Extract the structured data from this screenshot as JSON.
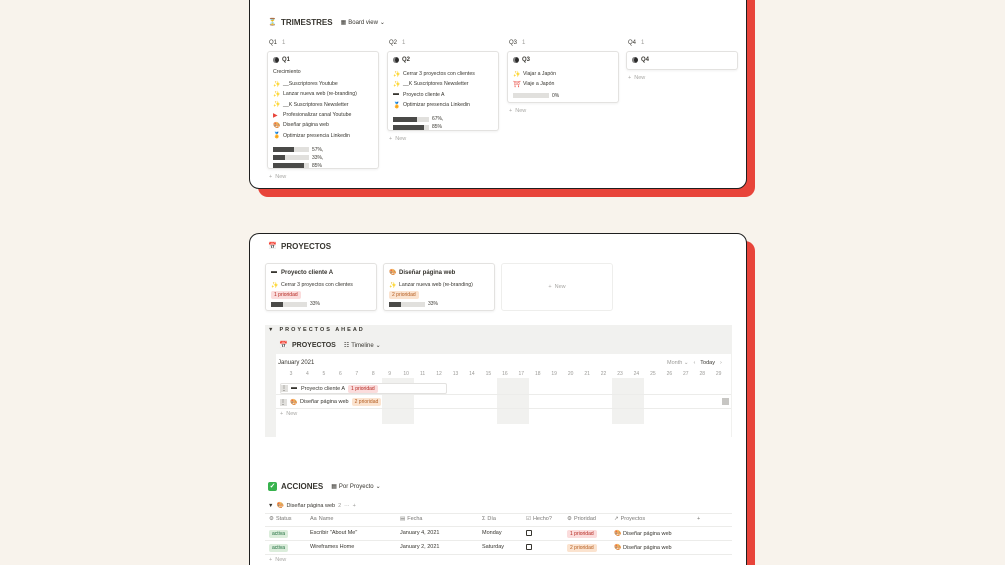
{
  "trimestres": {
    "title": "TRIMESTRES",
    "view": "Board view",
    "columns": [
      {
        "name": "Q1",
        "count": "1"
      },
      {
        "name": "Q2",
        "count": "1"
      },
      {
        "name": "Q3",
        "count": "1"
      },
      {
        "name": "Q4",
        "count": "1"
      }
    ],
    "cards": [
      {
        "title": "Q1",
        "subtitle": "Crecimiento",
        "items": [
          "__Suscriptores Youtube",
          "Lanzar nueva web (re-branding)",
          "__K Suscriptores Newsletter",
          "Profesionalizar canal Youtube",
          "Diseñar página web",
          "Optimizar presencia Linkedin"
        ],
        "bars": [
          {
            "label": "57%,",
            "value": 57
          },
          {
            "label": "33%,",
            "value": 33
          },
          {
            "label": "85%",
            "value": 85
          }
        ]
      },
      {
        "title": "Q2",
        "items": [
          "Cerrar 3 proyectos con clientes",
          "__K Suscriptores Newsletter",
          "Proyecto cliente A",
          "Optimizar presencia Linkedin"
        ],
        "bars": [
          {
            "label": "67%,",
            "value": 67
          },
          {
            "label": "85%",
            "value": 85
          }
        ]
      },
      {
        "title": "Q3",
        "items": [
          "Viajar a Japón",
          "Viaje a Japón"
        ],
        "bars": [
          {
            "label": "0%",
            "value": 0
          }
        ]
      },
      {
        "title": "Q4",
        "items": [],
        "bars": []
      }
    ],
    "new_label": "New"
  },
  "proyectos": {
    "title": "PROYECTOS",
    "cards": [
      {
        "title": "Proyecto cliente A",
        "item": "Cerrar 3 proyectos con clientes",
        "tag": "1 prioridad",
        "bar_label": "33%",
        "value": 33
      },
      {
        "title": "Diseñar página web",
        "item": "Lanzar nueva web (re-branding)",
        "tag": "2 prioridad",
        "bar_label": "33%",
        "value": 33
      }
    ],
    "new_label": "New"
  },
  "ahead": {
    "toggle_label": "PROYECTOS AHEAD",
    "title": "PROYECTOS",
    "view": "Timeline",
    "month": "January 2021",
    "scale": "Month",
    "today": "Today",
    "days": [
      "3",
      "4",
      "5",
      "6",
      "7",
      "8",
      "9",
      "10",
      "11",
      "12",
      "13",
      "14",
      "15",
      "16",
      "17",
      "18",
      "19",
      "20",
      "21",
      "22",
      "23",
      "24",
      "25",
      "26",
      "27",
      "28",
      "29"
    ],
    "rows": [
      {
        "name": "Proyecto cliente A",
        "tag": "1 prioridad"
      },
      {
        "name": "Diseñar página web",
        "tag": "2 prioridad"
      }
    ],
    "new_label": "New"
  },
  "acciones": {
    "title": "ACCIONES",
    "view": "Por Proyecto",
    "group": {
      "name": "Diseñar página web",
      "count": "2"
    },
    "columns": [
      "Status",
      "Name",
      "Fecha",
      "Día",
      "Hecho?",
      "Prioridad",
      "Proyectos"
    ],
    "rows": [
      {
        "status": "activa",
        "name": "Escribir \"About Me\"",
        "fecha": "January 4, 2021",
        "dia": "Monday",
        "prioridad": "1 prioridad",
        "proyecto": "Diseñar página web"
      },
      {
        "status": "activa",
        "name": "Wireframes Home",
        "fecha": "January 2, 2021",
        "dia": "Saturday",
        "prioridad": "2 prioridad",
        "proyecto": "Diseñar página web"
      }
    ],
    "new_label": "New"
  }
}
